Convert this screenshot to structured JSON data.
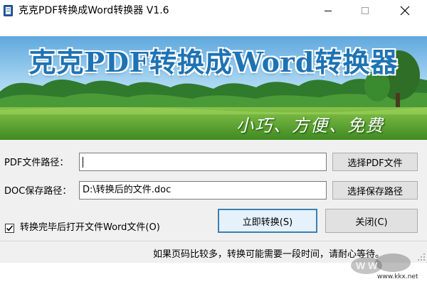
{
  "window": {
    "title": "克克PDF转换成Word转换器 V1.6",
    "controls": {
      "minimize": "minimize",
      "maximize": "maximize",
      "close": "close"
    }
  },
  "banner": {
    "title": "克克PDF转换成Word转换器",
    "slogan": "小巧、方便、免费"
  },
  "form": {
    "pdf_label": "PDF文件路径：",
    "pdf_value": "",
    "pdf_button": "选择PDF文件",
    "doc_label": "DOC保存路径：",
    "doc_value": "D:\\转换后的文件.doc",
    "doc_button": "选择保存路径",
    "open_after_label": "转换完毕后打开文件Word文件(O)",
    "open_after_checked": true,
    "convert_button": "立即转换(S)",
    "close_button": "关闭(C)"
  },
  "status": {
    "message": "如果页码比较多，转换可能需要一段时间，请耐心等待。"
  },
  "watermark": {
    "text": "www.kkx.net"
  },
  "colors": {
    "banner_title": "#1e73b4",
    "sky": "#8cc6ec",
    "grass": "#5aa032",
    "form_bg": "#f0f0f0"
  }
}
